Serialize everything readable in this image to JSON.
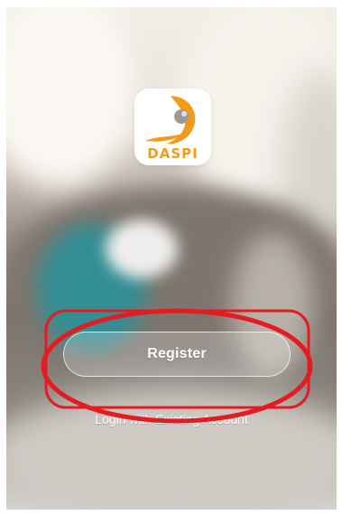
{
  "logo": {
    "text": "DASPI",
    "brand_colors": {
      "orange": "#f29b1b",
      "gray": "#9a9a9a"
    }
  },
  "actions": {
    "register_label": "Register",
    "login_label": "Login with Existing Account"
  },
  "annotation_color": "#e51b22"
}
